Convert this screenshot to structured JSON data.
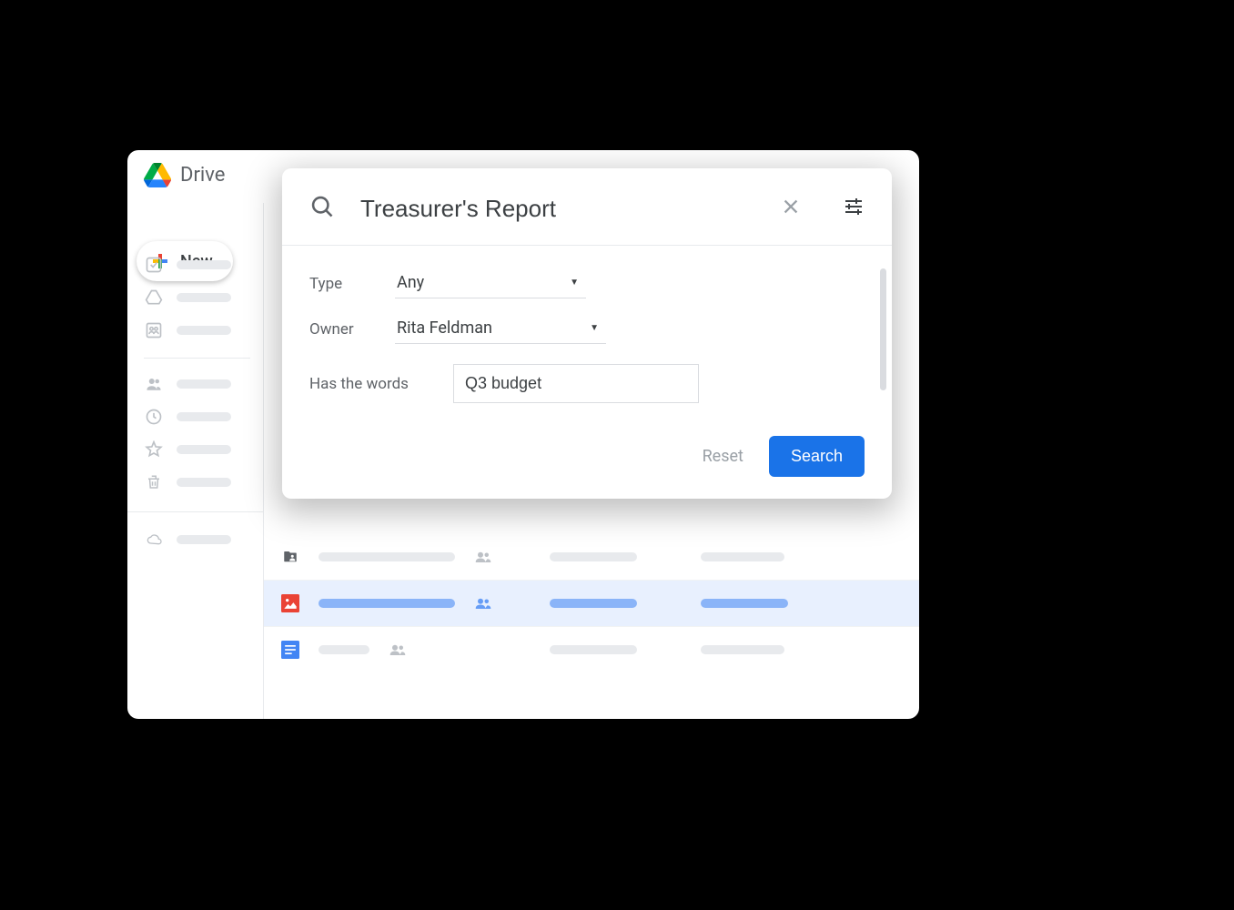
{
  "app": {
    "name": "Drive"
  },
  "new_button": {
    "label": "New"
  },
  "search": {
    "query": "Treasurer's Report",
    "filters": {
      "type_label": "Type",
      "type_value": "Any",
      "owner_label": "Owner",
      "owner_value": "Rita Feldman",
      "words_label": "Has the words",
      "words_value": "Q3 budget"
    },
    "reset_label": "Reset",
    "search_label": "Search"
  }
}
